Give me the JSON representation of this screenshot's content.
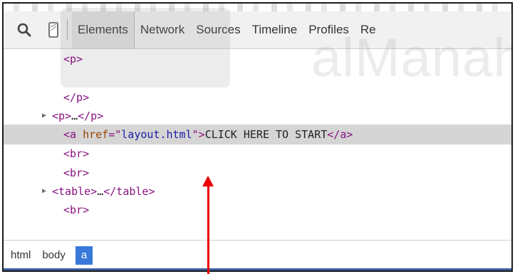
{
  "toolbar": {
    "tabs": [
      {
        "label": "Elements",
        "active": true
      },
      {
        "label": "Network",
        "active": false
      },
      {
        "label": "Sources",
        "active": false
      },
      {
        "label": "Timeline",
        "active": false
      },
      {
        "label": "Profiles",
        "active": false
      },
      {
        "label": "Re",
        "active": false
      }
    ],
    "icons": [
      "search-icon",
      "device-mode-icon"
    ]
  },
  "watermark": {
    "text": "alManah"
  },
  "dom_tree": {
    "lines": [
      {
        "expand": "",
        "open": "<p>",
        "attr_name": "",
        "attr_eq_quote": "",
        "attr_value": "",
        "attr_close_quote": "",
        "text": "",
        "close": ""
      },
      {
        "expand": "",
        "open": "",
        "attr_name": "",
        "attr_eq_quote": "",
        "attr_value": "",
        "attr_close_quote": "",
        "text": "",
        "close": ""
      },
      {
        "expand": "",
        "open": "</p>",
        "attr_name": "",
        "attr_eq_quote": "",
        "attr_value": "",
        "attr_close_quote": "",
        "text": "",
        "close": ""
      },
      {
        "expand": "▶",
        "open": "<p>",
        "attr_name": "",
        "attr_eq_quote": "",
        "attr_value": "",
        "attr_close_quote": "",
        "text": "…",
        "close": "</p>"
      },
      {
        "expand": "",
        "open": "<a ",
        "attr_name": "href",
        "attr_eq_quote": "=\"",
        "attr_value": "layout.html",
        "attr_close_quote": "\">",
        "text": "CLICK HERE TO START",
        "close": "</a>"
      },
      {
        "expand": "",
        "open": "<br>",
        "attr_name": "",
        "attr_eq_quote": "",
        "attr_value": "",
        "attr_close_quote": "",
        "text": "",
        "close": ""
      },
      {
        "expand": "",
        "open": "<br>",
        "attr_name": "",
        "attr_eq_quote": "",
        "attr_value": "",
        "attr_close_quote": "",
        "text": "",
        "close": ""
      },
      {
        "expand": "▶",
        "open": "<table>",
        "attr_name": "",
        "attr_eq_quote": "",
        "attr_value": "",
        "attr_close_quote": "",
        "text": "…",
        "close": "</table>"
      },
      {
        "expand": "",
        "open": "<br>",
        "attr_name": "",
        "attr_eq_quote": "",
        "attr_value": "",
        "attr_close_quote": "",
        "text": "",
        "close": ""
      }
    ],
    "selected_line": 4
  },
  "breadcrumbs": [
    {
      "label": "html",
      "active": false
    },
    {
      "label": "body",
      "active": false
    },
    {
      "label": "a",
      "active": true
    }
  ],
  "colors": {
    "tag": "#881280",
    "attr_name": "#994500",
    "attr_value": "#1a1aa6",
    "breadcrumb_active": "#3879d9",
    "annotation_arrow": "#ee0000"
  }
}
